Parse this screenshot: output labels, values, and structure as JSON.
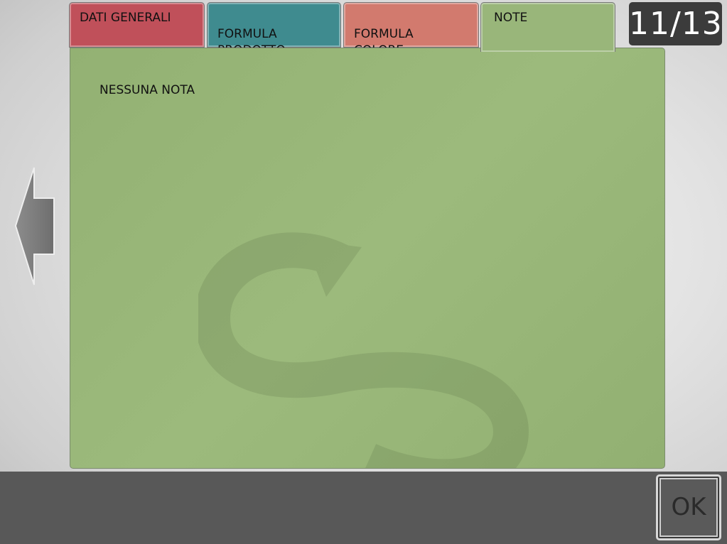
{
  "tabs": [
    {
      "label": "DATI GENERALI",
      "color": "#c0505a"
    },
    {
      "label": "FORMULA\nPRODOTTO",
      "color": "#3f8b8f"
    },
    {
      "label": "FORMULA\nCOLORE",
      "color": "#d27a6e"
    },
    {
      "label": "NOTE",
      "color": "#99b67a",
      "active": true
    }
  ],
  "page_counter": "11/13",
  "notes": {
    "text": "NESSUNA NOTA"
  },
  "navigation": {
    "back_icon": "left-arrow-icon"
  },
  "footer": {
    "ok_label": "OK"
  }
}
